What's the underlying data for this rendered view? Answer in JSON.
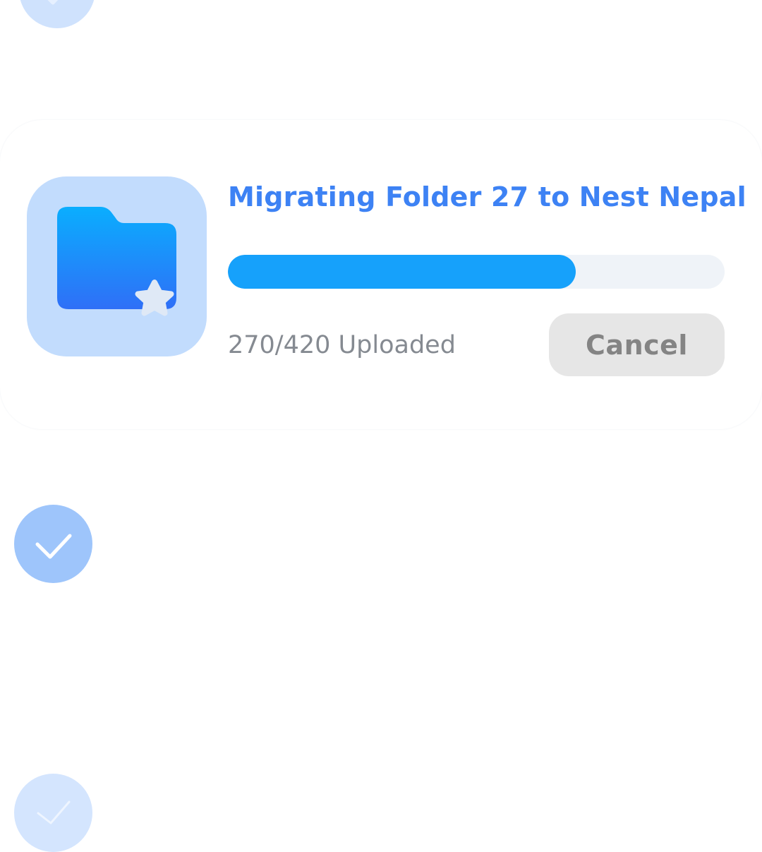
{
  "upload": {
    "title": "Migrating Folder 27 to Nest Nepal",
    "uploaded_count": 270,
    "total_count": 420,
    "progress_fraction": 0.7,
    "status_text": "270/420 Uploaded",
    "cancel_label": "Cancel",
    "icon": "folder-star-icon"
  },
  "steps": [
    {
      "icon": "checkmark-icon",
      "state": "completed"
    },
    {
      "icon": "checkmark-icon",
      "state": "completed"
    },
    {
      "icon": "checkmark-icon",
      "state": "completed"
    }
  ],
  "colors": {
    "accent": "#3d82f4",
    "progress_fill": "#16a1fb",
    "progress_track": "#eff3f8",
    "folder_tile": "#c2dcfd",
    "cancel_bg": "#e6e6e6",
    "muted_text": "#858a91"
  }
}
